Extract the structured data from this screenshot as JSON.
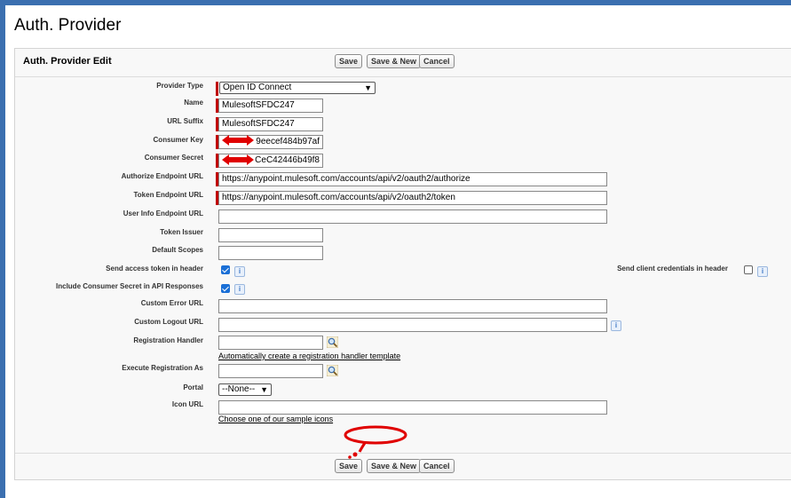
{
  "page": {
    "title": "Auth. Provider"
  },
  "section": {
    "title": "Auth. Provider Edit"
  },
  "buttons": {
    "save": "Save",
    "save_new": "Save & New",
    "cancel": "Cancel"
  },
  "fields": {
    "provider_type": {
      "label": "Provider Type",
      "value": "Open ID Connect"
    },
    "name": {
      "label": "Name",
      "value": "MulesoftSFDC247"
    },
    "url_suffix": {
      "label": "URL Suffix",
      "value": "MulesoftSFDC247"
    },
    "consumer_key": {
      "label": "Consumer Key",
      "value": "9eecef484b97af"
    },
    "consumer_secret": {
      "label": "Consumer Secret",
      "value": "CeC42446b49f8"
    },
    "authorize_endpoint_url": {
      "label": "Authorize Endpoint URL",
      "value": "https://anypoint.mulesoft.com/accounts/api/v2/oauth2/authorize"
    },
    "token_endpoint_url": {
      "label": "Token Endpoint URL",
      "value": "https://anypoint.mulesoft.com/accounts/api/v2/oauth2/token"
    },
    "user_info_endpoint_url": {
      "label": "User Info Endpoint URL",
      "value": ""
    },
    "token_issuer": {
      "label": "Token Issuer",
      "value": ""
    },
    "default_scopes": {
      "label": "Default Scopes",
      "value": ""
    },
    "send_access_token_in_header": {
      "label": "Send access token in header",
      "checked": true
    },
    "send_client_credentials_in_header": {
      "label": "Send client credentials in header",
      "checked": false
    },
    "include_consumer_secret": {
      "label": "Include Consumer Secret in API Responses",
      "checked": true
    },
    "custom_error_url": {
      "label": "Custom Error URL",
      "value": ""
    },
    "custom_logout_url": {
      "label": "Custom Logout URL",
      "value": ""
    },
    "registration_handler": {
      "label": "Registration Handler",
      "value": "",
      "link": "Automatically create a registration handler template"
    },
    "execute_registration_as": {
      "label": "Execute Registration As",
      "value": ""
    },
    "portal": {
      "label": "Portal",
      "value": "--None--"
    },
    "icon_url": {
      "label": "Icon URL",
      "value": "",
      "link": "Choose one of our sample icons"
    }
  },
  "icons": {
    "info": "i",
    "lookup": "magnifier-lookup-icon",
    "dropdown": "▼"
  },
  "colors": {
    "required": "#c00000",
    "accent": "#1a6fd6",
    "annotation": "#e00000"
  }
}
